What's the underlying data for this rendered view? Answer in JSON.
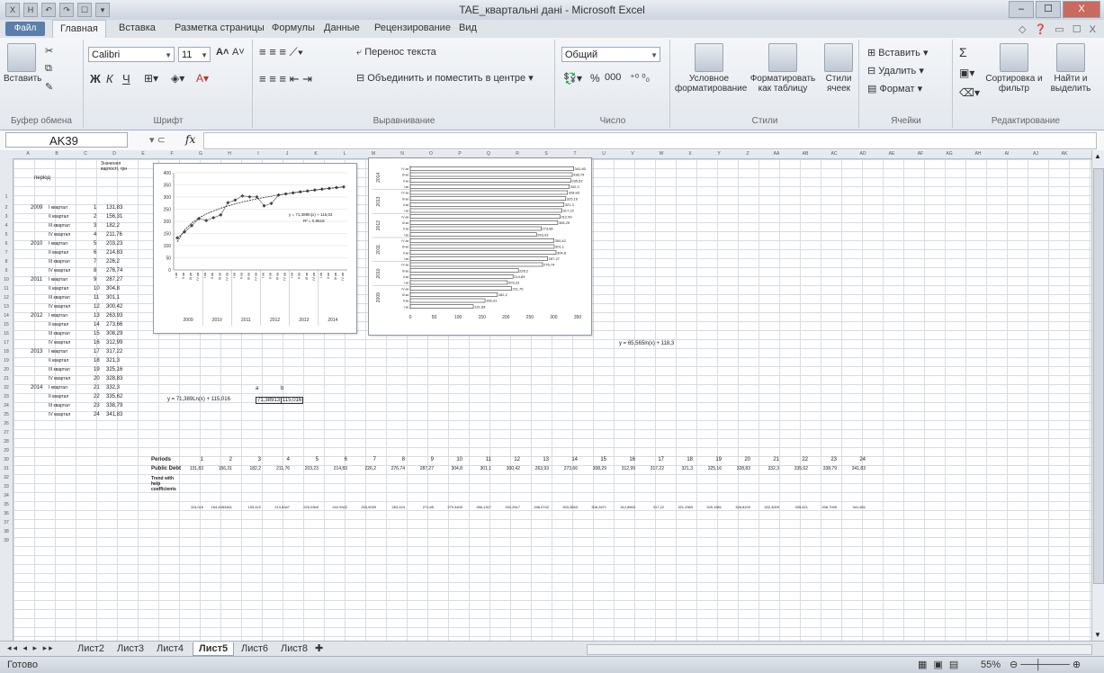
{
  "window": {
    "title": "TAE_квартальні дані - Microsoft Excel",
    "controls": [
      "–",
      "☐",
      "X"
    ]
  },
  "quick_access": [
    "X",
    "H",
    "↶",
    "↷",
    "☐",
    "▾"
  ],
  "ribbon_tabs": [
    "Файл",
    "Главная",
    "Вставка",
    "Разметка страницы",
    "Формулы",
    "Данные",
    "Рецензирование",
    "Вид"
  ],
  "ribbon_tab_right": "◇ ❓ ▭ ☐ X",
  "ribbon": {
    "clipboard": {
      "paste": "Вставить",
      "group": "Буфер обмена"
    },
    "font": {
      "family": "Calibri",
      "size": "11",
      "bold": "Ж",
      "italic": "К",
      "underline": "Ч",
      "grow": "A˄",
      "shrink": "A˅",
      "group": "Шрифт"
    },
    "alignment": {
      "wrap": "Перенос текста",
      "merge": "Объединить и поместить в центре",
      "group": "Выравнивание"
    },
    "number": {
      "format": "Общий",
      "percent": "%",
      "thousands": "000",
      "group": "Число"
    },
    "styles": {
      "conditional": "Условное форматирование",
      "table": "Форматировать как таблицу",
      "cell_styles": "Стили ячеек",
      "group": "Стили"
    },
    "cells": {
      "insert": "Вставить",
      "delete": "Удалить",
      "format": "Формат",
      "group": "Ячейки"
    },
    "editing": {
      "sum": "Σ",
      "sort": "Сортировка и фильтр",
      "find": "Найти и выделить",
      "group": "Редактирование"
    }
  },
  "formula_bar": {
    "name_box": "AK39",
    "fx": "fx",
    "value": ""
  },
  "sheet": {
    "col_headers": [
      "A",
      "B",
      "C",
      "D",
      "E",
      "F",
      "G",
      "H",
      "I",
      "J",
      "K",
      "L",
      "M",
      "N",
      "O",
      "P",
      "Q",
      "R",
      "S",
      "T",
      "U",
      "V",
      "W",
      "X",
      "Y",
      "Z",
      "AA",
      "AB",
      "AC",
      "AD",
      "AE",
      "AF",
      "AG",
      "AH",
      "AI",
      "AJ",
      "AK"
    ],
    "header_label": "період",
    "header_col3": "Значення вартості, грн",
    "rows": [
      {
        "r": "2",
        "y": "2009",
        "q": "І квартал",
        "n": "1",
        "v": "131,83"
      },
      {
        "r": "3",
        "y": "",
        "q": "ІІ квартал",
        "n": "2",
        "v": "156,31"
      },
      {
        "r": "4",
        "y": "",
        "q": "ІІІ квартал",
        "n": "3",
        "v": "182,2"
      },
      {
        "r": "5",
        "y": "",
        "q": "IV квартал",
        "n": "4",
        "v": "211,76"
      },
      {
        "r": "6",
        "y": "2010",
        "q": "І квартал",
        "n": "5",
        "v": "203,23"
      },
      {
        "r": "7",
        "y": "",
        "q": "ІІ квартал",
        "n": "6",
        "v": "214,83"
      },
      {
        "r": "8",
        "y": "",
        "q": "ІІІ квартал",
        "n": "7",
        "v": "226,2"
      },
      {
        "r": "9",
        "y": "",
        "q": "IV квартал",
        "n": "8",
        "v": "276,74"
      },
      {
        "r": "10",
        "y": "2011",
        "q": "І квартал",
        "n": "9",
        "v": "287,27"
      },
      {
        "r": "11",
        "y": "",
        "q": "ІІ квартал",
        "n": "10",
        "v": "304,8"
      },
      {
        "r": "12",
        "y": "",
        "q": "ІІІ квартал",
        "n": "11",
        "v": "301,1"
      },
      {
        "r": "13",
        "y": "",
        "q": "IV квартал",
        "n": "12",
        "v": "300,42"
      },
      {
        "r": "14",
        "y": "2012",
        "q": "І квартал",
        "n": "13",
        "v": "263,93"
      },
      {
        "r": "15",
        "y": "",
        "q": "ІІ квартал",
        "n": "14",
        "v": "273,66"
      },
      {
        "r": "16",
        "y": "",
        "q": "ІІІ квартал",
        "n": "15",
        "v": "308,29"
      },
      {
        "r": "17",
        "y": "",
        "q": "IV квартал",
        "n": "16",
        "v": "312,99"
      },
      {
        "r": "18",
        "y": "2013",
        "q": "І квартал",
        "n": "17",
        "v": "317,22"
      },
      {
        "r": "19",
        "y": "",
        "q": "ІІ квартал",
        "n": "18",
        "v": "321,3"
      },
      {
        "r": "20",
        "y": "",
        "q": "ІІІ квартал",
        "n": "19",
        "v": "325,16"
      },
      {
        "r": "21",
        "y": "",
        "q": "IV квартал",
        "n": "20",
        "v": "328,83"
      },
      {
        "r": "22",
        "y": "2014",
        "q": "І квартал",
        "n": "21",
        "v": "332,3"
      },
      {
        "r": "23",
        "y": "",
        "q": "ІІ квартал",
        "n": "22",
        "v": "335,62"
      },
      {
        "r": "24",
        "y": "",
        "q": "ІІІ квартал",
        "n": "23",
        "v": "338,79"
      },
      {
        "r": "25",
        "y": "",
        "q": "IV квартал",
        "n": "24",
        "v": "341,83"
      }
    ],
    "eq_text": "y = 71,389Ln(x) + 115,016",
    "eq_right": "y = 65,565ln(x) + 118,3",
    "ab_table": {
      "a_label": "a",
      "b_label": "b",
      "a": "71,38913",
      "b": "115,016"
    },
    "bottom": {
      "periods_label": "Periods",
      "public_debt_label": "Public Debt",
      "trend_label": "Trend with help coefficients",
      "periods": [
        "1",
        "2",
        "3",
        "4",
        "5",
        "6",
        "7",
        "8",
        "9",
        "10",
        "11",
        "12",
        "13",
        "14",
        "15",
        "16",
        "17",
        "18",
        "19",
        "20",
        "21",
        "22",
        "23",
        "24"
      ],
      "public_debt": [
        "131,83",
        "156,31",
        "182,2",
        "211,76",
        "203,23",
        "214,83",
        "226,2",
        "276,74",
        "287,27",
        "304,8",
        "301,1",
        "300,42",
        "263,93",
        "273,66",
        "308,29",
        "312,99",
        "317,22",
        "321,3",
        "325,16",
        "328,83",
        "332,3",
        "335,62",
        "338,79",
        "341,83"
      ],
      "trend": [
        "115,016",
        "164,4053461",
        "193,422",
        "213,8347",
        "229,0300",
        "242,9922",
        "253,9039",
        "263,424",
        "271,85",
        "279,3405",
        "286,1317",
        "292,2617",
        "298,0742",
        "303,3653",
        "308,2871",
        "312,8553",
        "317,22",
        "321,2983",
        "325,1581",
        "328,8100",
        "332,3009",
        "335,621",
        "338,7935",
        "341,831"
      ]
    }
  },
  "line_chart": {
    "type": "line",
    "title": "",
    "y_ticks": [
      "0",
      "50",
      "100",
      "150",
      "200",
      "250",
      "300",
      "350",
      "400"
    ],
    "x_groups": [
      "2009",
      "2010",
      "2011",
      "2012",
      "2013",
      "2014"
    ],
    "x_tick_labels": [
      "І кв",
      "ІІ кв",
      "ІІІ кв",
      "IV кв",
      "І кв",
      "ІІ кв",
      "ІІІ кв",
      "IV кв",
      "І кв",
      "ІІ кв",
      "ІІІ кв",
      "IV кв",
      "І кв",
      "ІІ кв",
      "ІІІ кв",
      "IV кв",
      "І кв",
      "ІІ кв",
      "ІІІ кв",
      "IV кв",
      "І кв",
      "ІІ кв",
      "ІІІ кв",
      "IV кв"
    ],
    "trend_eq": "y = 71,389ln(x) + 115,02",
    "r2": "R² = 0,9519",
    "chart_data": {
      "type": "line",
      "x": [
        1,
        2,
        3,
        4,
        5,
        6,
        7,
        8,
        9,
        10,
        11,
        12,
        13,
        14,
        15,
        16,
        17,
        18,
        19,
        20,
        21,
        22,
        23,
        24
      ],
      "values": [
        131.83,
        156.31,
        182.2,
        211.76,
        203.23,
        214.83,
        226.2,
        276.74,
        287.27,
        304.8,
        301.1,
        300.42,
        263.93,
        273.66,
        308.29,
        312.99,
        317.22,
        321.3,
        325.16,
        328.83,
        332.3,
        335.62,
        338.79,
        341.83
      ],
      "ylim": [
        0,
        400
      ]
    }
  },
  "bar_chart": {
    "type": "bar",
    "x_ticks": [
      "0",
      "50",
      "100",
      "150",
      "200",
      "250",
      "300",
      "350"
    ],
    "y_groups": [
      "2014",
      "2013",
      "2012",
      "2011",
      "2010",
      "2009"
    ],
    "data_labels": [
      "341,83",
      "338,79",
      "335,62",
      "332,3",
      "328,83",
      "325,16",
      "321,3",
      "317,22",
      "312,99",
      "308,29",
      "273,66",
      "263,93",
      "300,42",
      "301,1",
      "304,8",
      "287,27",
      "276,74",
      "226,2",
      "214,83",
      "203,23",
      "211,76",
      "182,2",
      "156,31",
      "131,83"
    ],
    "chart_data": {
      "type": "bar",
      "orientation": "horizontal",
      "values": [
        341.83,
        338.79,
        335.62,
        332.3,
        328.83,
        325.16,
        321.3,
        317.22,
        312.99,
        308.29,
        273.66,
        263.93,
        300.42,
        301.1,
        304.8,
        287.27,
        276.74,
        226.2,
        214.83,
        203.23,
        211.76,
        182.2,
        156.31,
        131.83
      ],
      "xlim": [
        0,
        350
      ]
    }
  },
  "sheet_tabs": [
    "Лист2",
    "Лист3",
    "Лист4",
    "Лист5",
    "Лист6",
    "Лист8"
  ],
  "active_sheet": "Лист5",
  "status": {
    "ready": "Готово",
    "zoom": "55%"
  }
}
